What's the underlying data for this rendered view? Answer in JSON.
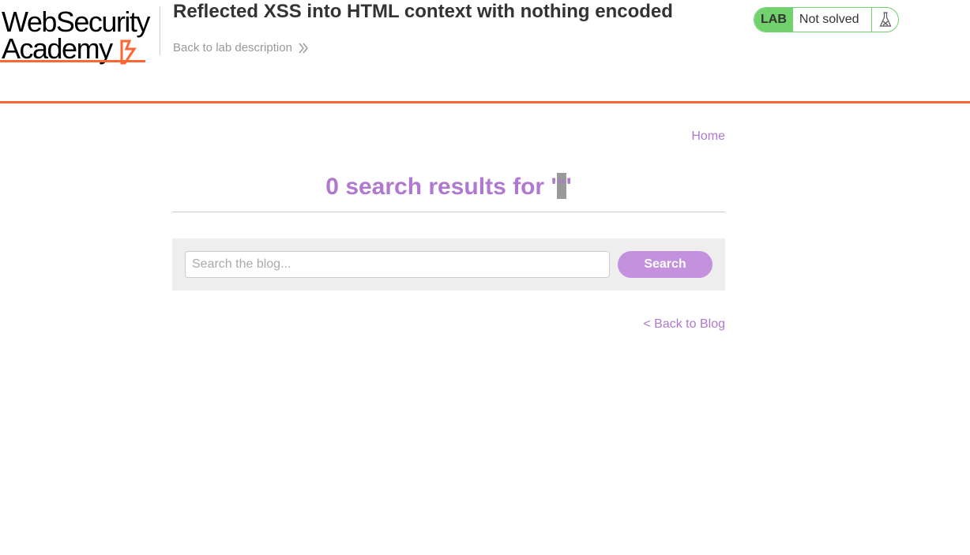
{
  "logo": {
    "line1": "WebSecurity",
    "line2": "Academy",
    "accent_color": "#ff6633"
  },
  "lab": {
    "title": "Reflected XSS into HTML context with nothing encoded",
    "back_label": "Back to lab description",
    "badge": "LAB",
    "status": "Not solved",
    "status_color": "#70d16d",
    "flask_icon": "flask-icon"
  },
  "nav": {
    "home_label": "Home"
  },
  "results": {
    "count": "0",
    "text": "search results for",
    "open_quote": "'",
    "query": "\"",
    "close_quote": "'"
  },
  "search": {
    "placeholder": "Search the blog...",
    "value": "",
    "button_label": "Search"
  },
  "footer_link": {
    "label": "< Back to Blog"
  },
  "colors": {
    "link": "#b078cf",
    "button": "#c391de",
    "header_rule": "#ff6633"
  }
}
